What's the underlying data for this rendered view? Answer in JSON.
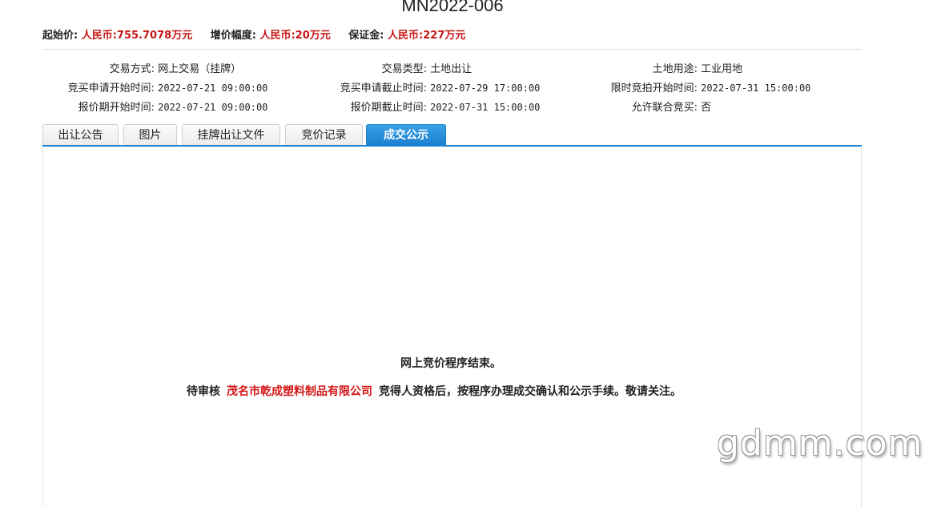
{
  "header": {
    "title": "MN2022-006"
  },
  "prices": {
    "start_label": "起始价:",
    "start_value": "人民币:755.7078万元",
    "step_label": "增价幅度:",
    "step_value": "人民币:20万元",
    "deposit_label": "保证金:",
    "deposit_value": "人民币:227万元"
  },
  "info": {
    "trade_method_label": "交易方式:",
    "trade_method_value": "网上交易（挂牌）",
    "trade_type_label": "交易类型:",
    "trade_type_value": "土地出让",
    "land_use_label": "土地用途:",
    "land_use_value": "工业用地",
    "apply_start_label": "竞买申请开始时间:",
    "apply_start_value": "2022-07-21 09:00:00",
    "apply_end_label": "竞买申请截止时间:",
    "apply_end_value": "2022-07-29 17:00:00",
    "timed_bid_start_label": "限时竞拍开始时间:",
    "timed_bid_start_value": "2022-07-31 15:00:00",
    "quote_start_label": "报价期开始时间:",
    "quote_start_value": "2022-07-21 09:00:00",
    "quote_end_label": "报价期截止时间:",
    "quote_end_value": "2022-07-31 15:00:00",
    "joint_bid_label": "允许联合竞买:",
    "joint_bid_value": "否"
  },
  "tabs": [
    {
      "label": "出让公告"
    },
    {
      "label": "图片"
    },
    {
      "label": "挂牌出让文件"
    },
    {
      "label": "竞价记录"
    },
    {
      "label": "成交公示"
    }
  ],
  "content": {
    "message_end": "网上竞价程序结束。",
    "pending_prefix": "待审核",
    "company": "茂名市乾成塑料制品有限公司",
    "pending_suffix": "竞得人资格后，按程序办理成交确认和公示手续。敬请关注。"
  },
  "watermark": "gdmm.com",
  "colors": {
    "accent": "#1c84d4",
    "highlight": "#c81414"
  }
}
